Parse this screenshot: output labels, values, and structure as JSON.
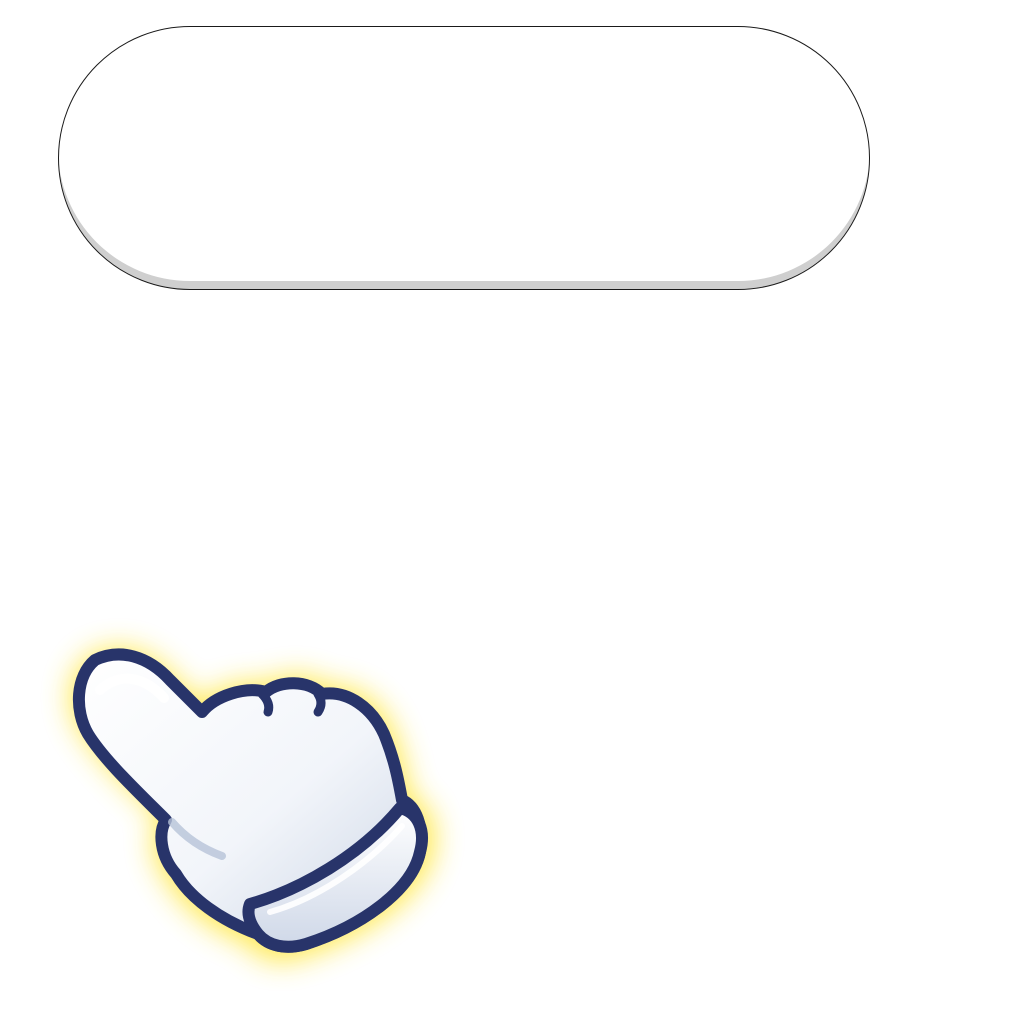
{
  "button": {
    "label": "",
    "fill_color": "#ffffff",
    "border_color": "#1a1a1a",
    "shadow_color": "#cfcfcf"
  },
  "pointer": {
    "icon": "hand-pointer-icon",
    "glove_color": "#ffffff",
    "outline_color": "#28346a",
    "glow_color": "#ffe84a"
  }
}
